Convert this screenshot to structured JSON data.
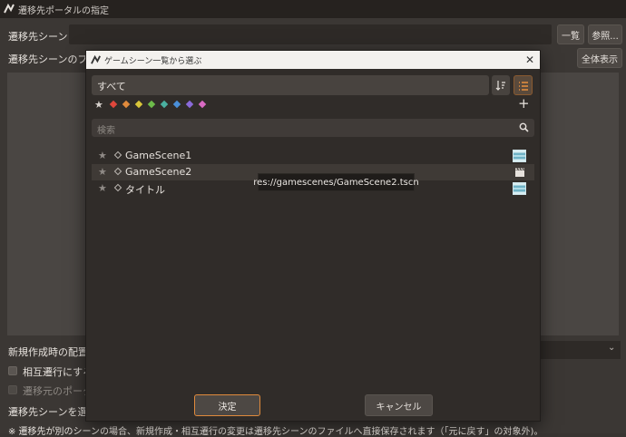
{
  "window": {
    "title": "遷移先ポータルの指定"
  },
  "main": {
    "scene_label": "遷移先シーン",
    "list_button": "一覧",
    "browse_button": "参照...",
    "preview_label": "遷移先シーンのプレ",
    "show_all_button": "全体表示",
    "placement_label": "新規作成時の配置先",
    "mutual_label": "相互遷行にする",
    "source_portal_label": "遷移元のポータ",
    "select_label": "遷移先シーンを選択",
    "footnote": "※ 遷移先が別のシーンの場合、新規作成・相互遷行の変更は遷移先シーンのファイルへ直接保存されます（「元に戻す」の対象外)。"
  },
  "dialog": {
    "title": "ゲームシーン一覧から選ぶ",
    "filter_value": "すべて",
    "colors": [
      "#e0473c",
      "#e08a3c",
      "#d9c63a",
      "#6dbb4a",
      "#4ab0a0",
      "#4a8fd9",
      "#8a6ad9",
      "#d96ac3"
    ],
    "search_placeholder": "検索",
    "items": [
      {
        "name": "GameScene1"
      },
      {
        "name": "GameScene2"
      },
      {
        "name": "タイトル"
      }
    ],
    "tooltip": "res://gamescenes/GameScene2.tscn",
    "ok_label": "決定",
    "cancel_label": "キャンセル"
  }
}
